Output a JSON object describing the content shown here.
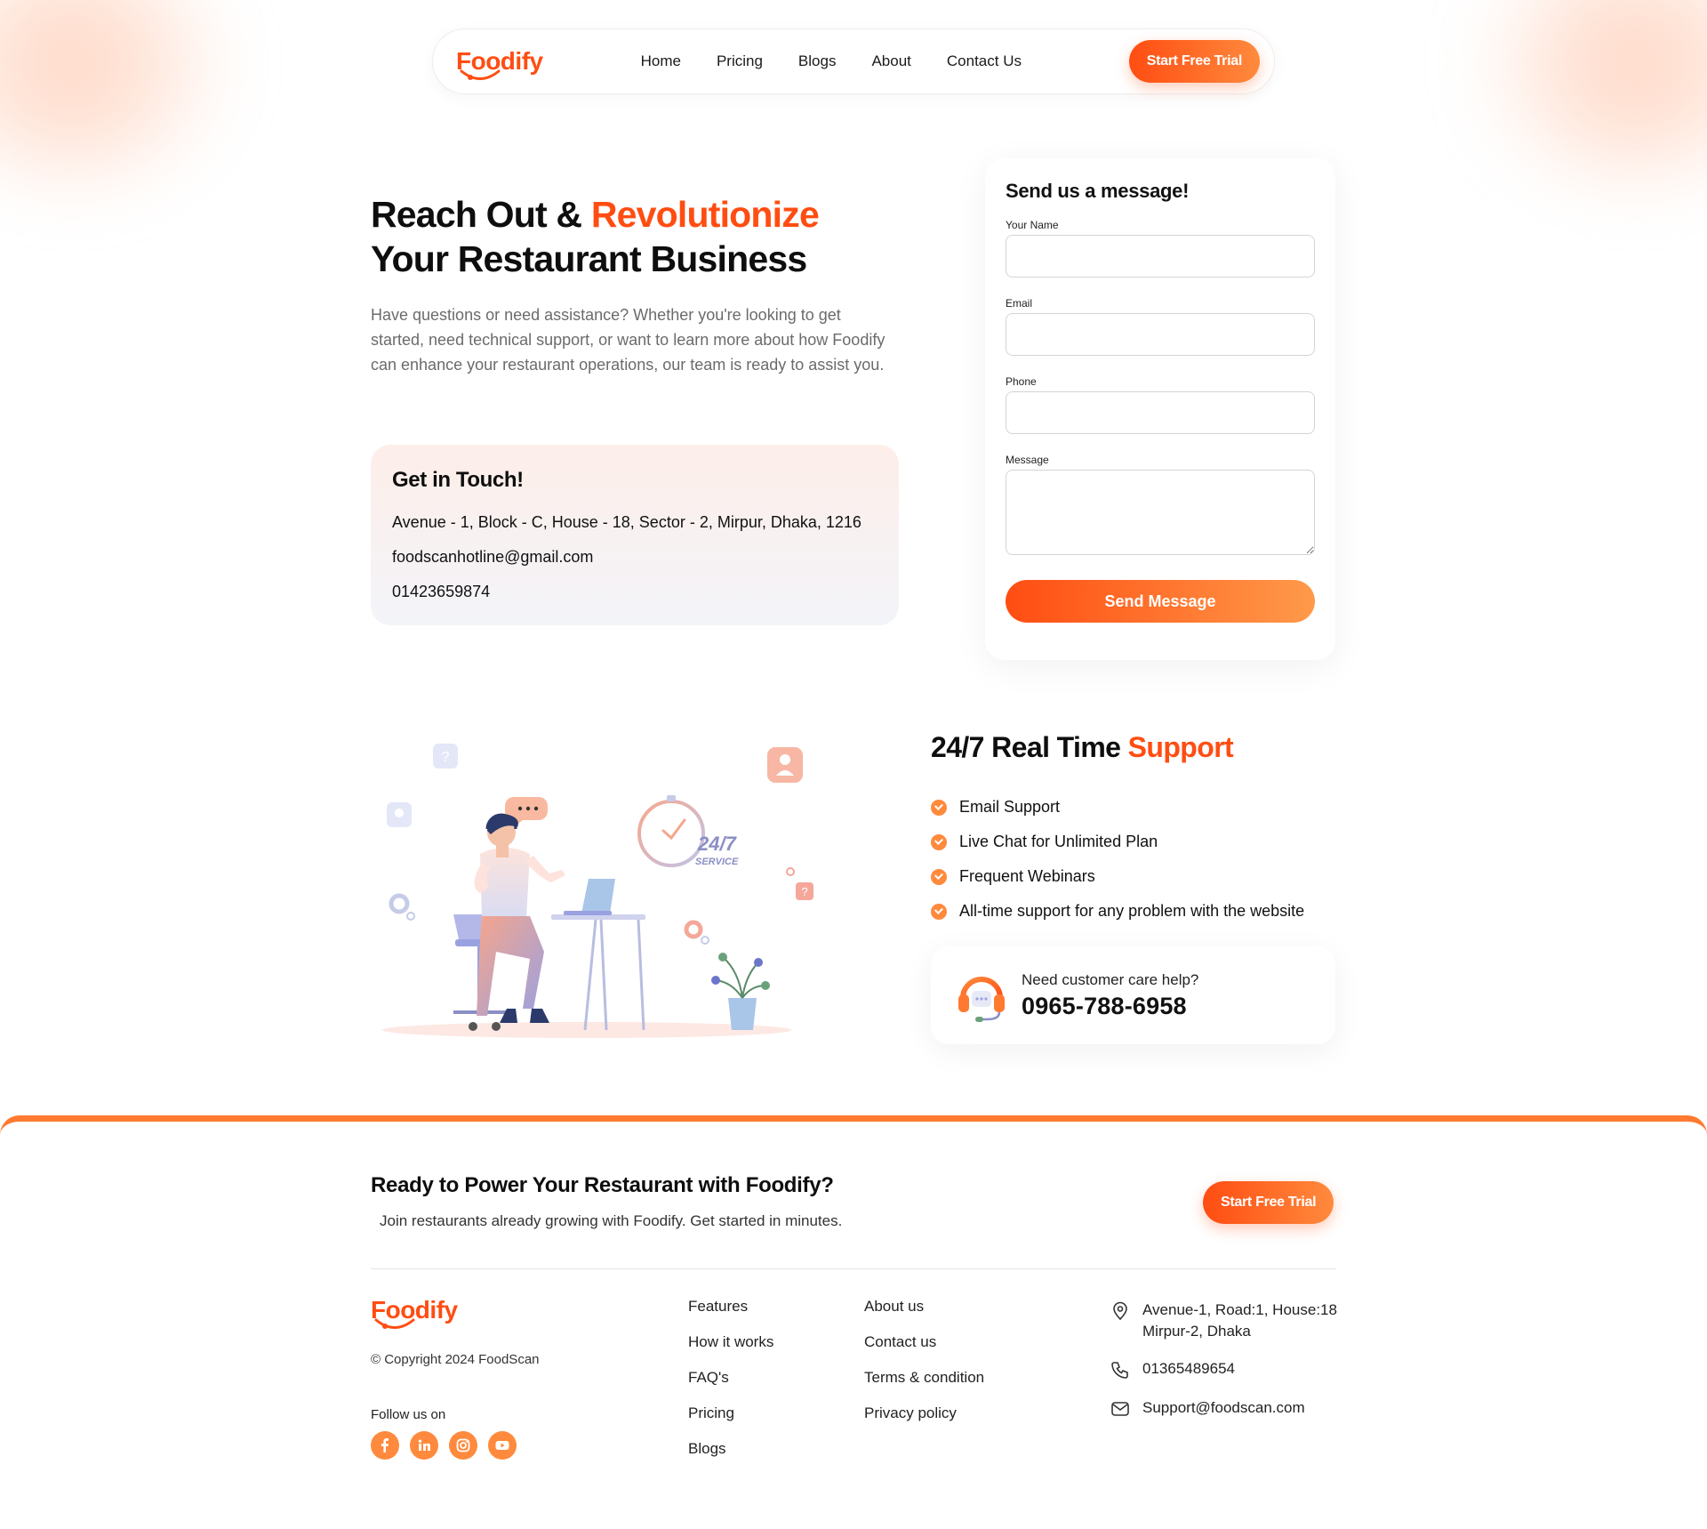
{
  "brand": {
    "name": "Foodify",
    "accent": "#ff4d12",
    "accent_light": "#ff8a3d"
  },
  "nav": {
    "links": [
      "Home",
      "Pricing",
      "Blogs",
      "About",
      "Contact Us"
    ],
    "cta": "Start Free Trial"
  },
  "hero": {
    "title_part1": "Reach Out & ",
    "title_accent": "Revolutionize",
    "title_part2": "Your Restaurant Business",
    "description": "Have questions or need assistance? Whether you're looking to get started, need technical support, or want to learn more about how Foodify can enhance your restaurant operations, our team is ready to assist you."
  },
  "touch": {
    "title": "Get in Touch!",
    "address": "Avenue - 1, Block - C, House - 18, Sector - 2, Mirpur, Dhaka, 1216",
    "email": "foodscanhotline@gmail.com",
    "phone": "01423659874"
  },
  "form": {
    "title": "Send us a message!",
    "name_label": "Your Name",
    "email_label": "Email",
    "phone_label": "Phone",
    "message_label": "Message",
    "name_value": "",
    "email_value": "",
    "phone_value": "",
    "message_value": "",
    "submit": "Send Message"
  },
  "illustration": {
    "service_label": "24/7",
    "service_sub": "SERVICE"
  },
  "support": {
    "title_part1": "24/7 Real Time ",
    "title_accent": "Support",
    "items": [
      "Email Support",
      "Live Chat for Unlimited Plan",
      "Frequent Webinars",
      "All-time support for any problem with the website"
    ],
    "care_label": "Need customer care help?",
    "care_phone": "0965-788-6958"
  },
  "footer": {
    "cta_title": "Ready to Power Your Restaurant with Foodify?",
    "cta_sub": "Join restaurants already growing with Foodify. Get started in minutes.",
    "cta_button": "Start Free Trial",
    "copyright": "© Copyright 2024 FoodScan",
    "follow": "Follow us on",
    "socials": [
      "facebook-icon",
      "linkedin-icon",
      "instagram-icon",
      "youtube-icon"
    ],
    "col1": [
      "Features",
      "How it works",
      "FAQ's",
      "Pricing",
      "Blogs"
    ],
    "col2": [
      "About us",
      "Contact us",
      "Terms & condition",
      "Privacy policy"
    ],
    "address_line1": "Avenue-1, Road:1, House:18",
    "address_line2": "Mirpur-2, Dhaka",
    "phone": "01365489654",
    "email": "Support@foodscan.com"
  }
}
